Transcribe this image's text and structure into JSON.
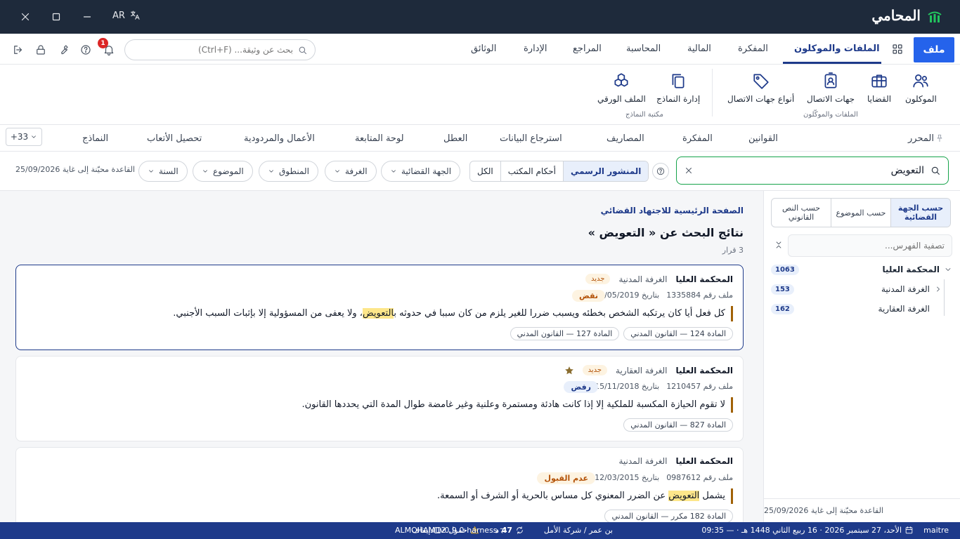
{
  "app": {
    "brand": "المحامي",
    "language": "AR",
    "colors": {
      "primary": "#1e3a8a",
      "accent": "#2563eb",
      "titlebar": "#1e2a3b",
      "search_ok": "#16a34a",
      "highlight": "#fde68a"
    }
  },
  "toolbar": {
    "file_label": "ملف",
    "tabs": [
      "الملفات والموكلون",
      "المفكرة",
      "المالية",
      "المحاسبة",
      "المراجع",
      "الإدارة",
      "الوثائق"
    ],
    "active_tab": "الملفات والموكلون",
    "search_placeholder": "بحث عن وثيقة... (Ctrl+F)",
    "notifications_count": "1"
  },
  "ribbon": {
    "buttons": [
      "الموكلون",
      "القضايا",
      "جهات الاتصال",
      "أنواع جهات الاتصال",
      "إدارة النماذج",
      "الملف الورقي"
    ],
    "group1": "الملفات والموكّلون",
    "group2": "مكتبة النماذج"
  },
  "law_tabs": {
    "items": [
      "المحرر",
      "القوانين",
      "المفكرة",
      "المصاريف",
      "استرجاع البيانات",
      "العطل",
      "لوحة المتابعة",
      "الأعمال والمردودية",
      "تحصيل الأتعاب",
      "النماذج"
    ],
    "more_label": "+33"
  },
  "filters": {
    "query": "التعويض",
    "segments": [
      "المنشور الرسمي",
      "أحكام المكتب",
      "الكل"
    ],
    "active_segment": "المنشور الرسمي",
    "dropdowns": [
      "الجهة القضائية",
      "الغرفة",
      "المنطوق",
      "الموضوع",
      "السنة"
    ],
    "db_note": "القاعدة محيّنة إلى غاية 25/09/2026"
  },
  "results": {
    "breadcrumb": "الصفحة الرئيسية للاجتهاد القضائي",
    "title": "نتائج البحث عن « التعويض »",
    "count": "3 قرار",
    "cards": [
      {
        "court": "المحكمة العليا",
        "chamber": "الغرفة المدنية",
        "badge": "جديد",
        "file_no": "ملف رقم 1335884",
        "date": "بتاريخ 22/05/2019",
        "outcome": "نقض",
        "text_before": "كل فعل أيا كان يرتكبه الشخص بخطئه ويسبب ضررا للغير يلزم من كان سببا في حدوثه ب",
        "text_hl": "التعويض",
        "text_after": "، ولا يعفى من المسؤولية إلا بإثبات السبب الأجنبي.",
        "tags": [
          "المادة 124 — القانون المدني",
          "المادة 127 — القانون المدني"
        ]
      },
      {
        "court": "المحكمة العليا",
        "chamber": "الغرفة العقارية",
        "badge": "جديد",
        "file_no": "ملف رقم 1210457",
        "date": "بتاريخ 15/11/2018",
        "outcome": "رفض",
        "text": "لا تقوم الحيازة المكسبة للملكية إلا إذا كانت هادئة ومستمرة وعلنية وغير غامضة طوال المدة التي يحددها القانون.",
        "tags": [
          "المادة 827 — القانون المدني"
        ]
      },
      {
        "court": "المحكمة العليا",
        "chamber": "الغرفة المدنية",
        "file_no": "ملف رقم 0987612",
        "date": "بتاريخ 12/03/2015",
        "outcome": "عدم القبول",
        "text_before": "يشمل ",
        "text_hl": "التعويض",
        "text_after": " عن الضرر المعنوي كل مساس بالحرية أو الشرف أو السمعة.",
        "tags": [
          "المادة 182 مكرر — القانون المدني"
        ]
      }
    ]
  },
  "index_panel": {
    "tabs": [
      "حسب الجهة القضائية",
      "حسب الموضوع",
      "حسب النص القانوني"
    ],
    "active_tab": "حسب الجهة القضائية",
    "filter_placeholder": "تصفية الفهرس...",
    "tree": [
      {
        "label": "المحكمة العليا",
        "count": "1063"
      },
      {
        "label": "الغرفة المدنية",
        "count": "153"
      },
      {
        "label": "الغرفة العقارية",
        "count": "162"
      }
    ],
    "footer": "القاعدة محيّنة إلى غاية 25/09/2026"
  },
  "status": {
    "user": "maitre",
    "datetime": "الأحد، 27 سبتمبر 2026 · 16 ربيع الثاني 1448 هـ · — 09:35",
    "org": "بن عمر / شركة الأمل",
    "days": "47 د",
    "timer": "خمول 12 د",
    "pause": "إيقاف",
    "version": "ALMOHAMI v0.9.0-harness"
  }
}
